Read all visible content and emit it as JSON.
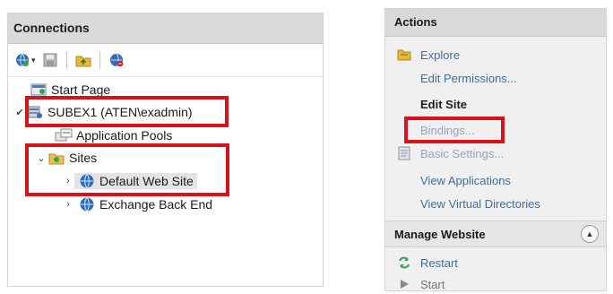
{
  "connections": {
    "title": "Connections",
    "toolbar": [
      "globe-connect-icon",
      "save-icon",
      "folder-up-icon",
      "globe-disconnect-icon"
    ],
    "tree": {
      "start_page": "Start Page",
      "server": "SUBEX1 (ATEN\\exadmin)",
      "app_pools": "Application Pools",
      "sites": "Sites",
      "default_site": "Default Web Site",
      "exchange_backend": "Exchange Back End"
    }
  },
  "actions": {
    "title": "Actions",
    "explore": "Explore",
    "edit_permissions": "Edit Permissions...",
    "edit_site_heading": "Edit Site",
    "bindings": "Bindings...",
    "basic_settings": "Basic Settings...",
    "view_applications": "View Applications",
    "view_virtual_directories": "View Virtual Directories",
    "manage_website": "Manage Website",
    "restart": "Restart",
    "start": "Start"
  },
  "colors": {
    "highlight_box": "#d8121b",
    "link": "#3b6fa8",
    "panel_header": "#d9d9d9"
  }
}
